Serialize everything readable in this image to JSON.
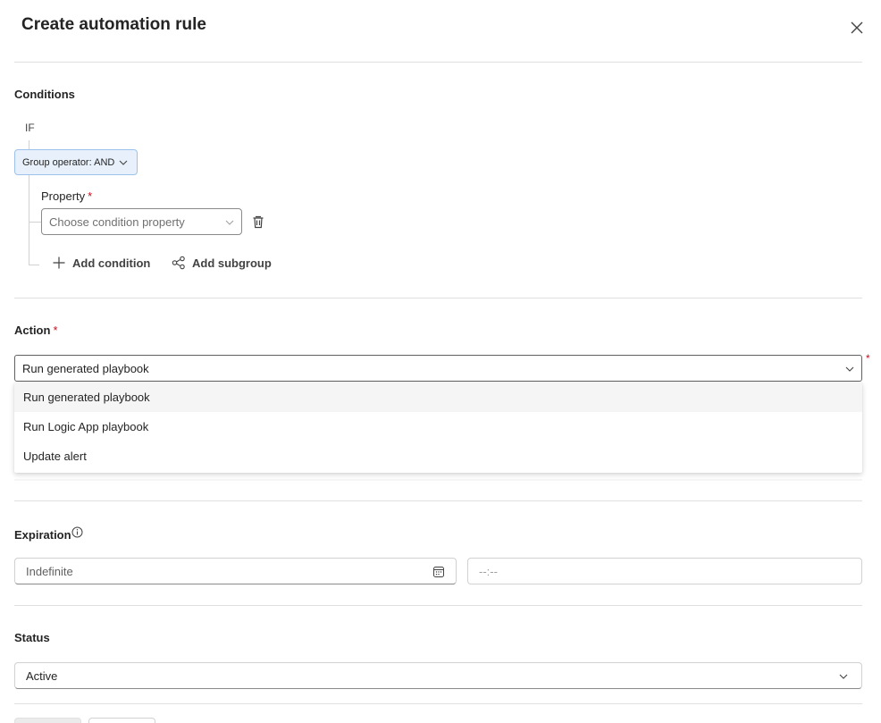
{
  "panel": {
    "title": "Create automation rule"
  },
  "conditions": {
    "section_label": "Conditions",
    "if_label": "IF",
    "group_operator_label": "Group operator: AND",
    "property_label": "Property",
    "property_required_mark": "*",
    "property_placeholder": "Choose condition property",
    "add_condition_label": "Add condition",
    "add_subgroup_label": "Add subgroup"
  },
  "action": {
    "section_label": "Action",
    "required_mark": "*",
    "selected_value": "Run generated playbook",
    "side_required_mark": "*",
    "options": [
      {
        "label": "Run generated playbook",
        "selected": true
      },
      {
        "label": "Run Logic App playbook",
        "selected": false
      },
      {
        "label": "Update alert",
        "selected": false
      }
    ]
  },
  "expiration": {
    "section_label": "Expiration",
    "date_placeholder": "Indefinite",
    "time_placeholder": "--:--"
  },
  "status": {
    "section_label": "Status",
    "selected_value": "Active"
  },
  "colors": {
    "accent": "#0f6cbd",
    "required": "#c50f1f",
    "group_bg": "#e8f1fb",
    "divider": "#e0e0e0"
  },
  "icons": {
    "close": "close-icon",
    "chevron": "chevron-down-icon",
    "trash": "delete-icon",
    "add": "add-icon",
    "subgroup": "subgroup-icon",
    "info": "info-icon",
    "calendar": "calendar-icon"
  }
}
